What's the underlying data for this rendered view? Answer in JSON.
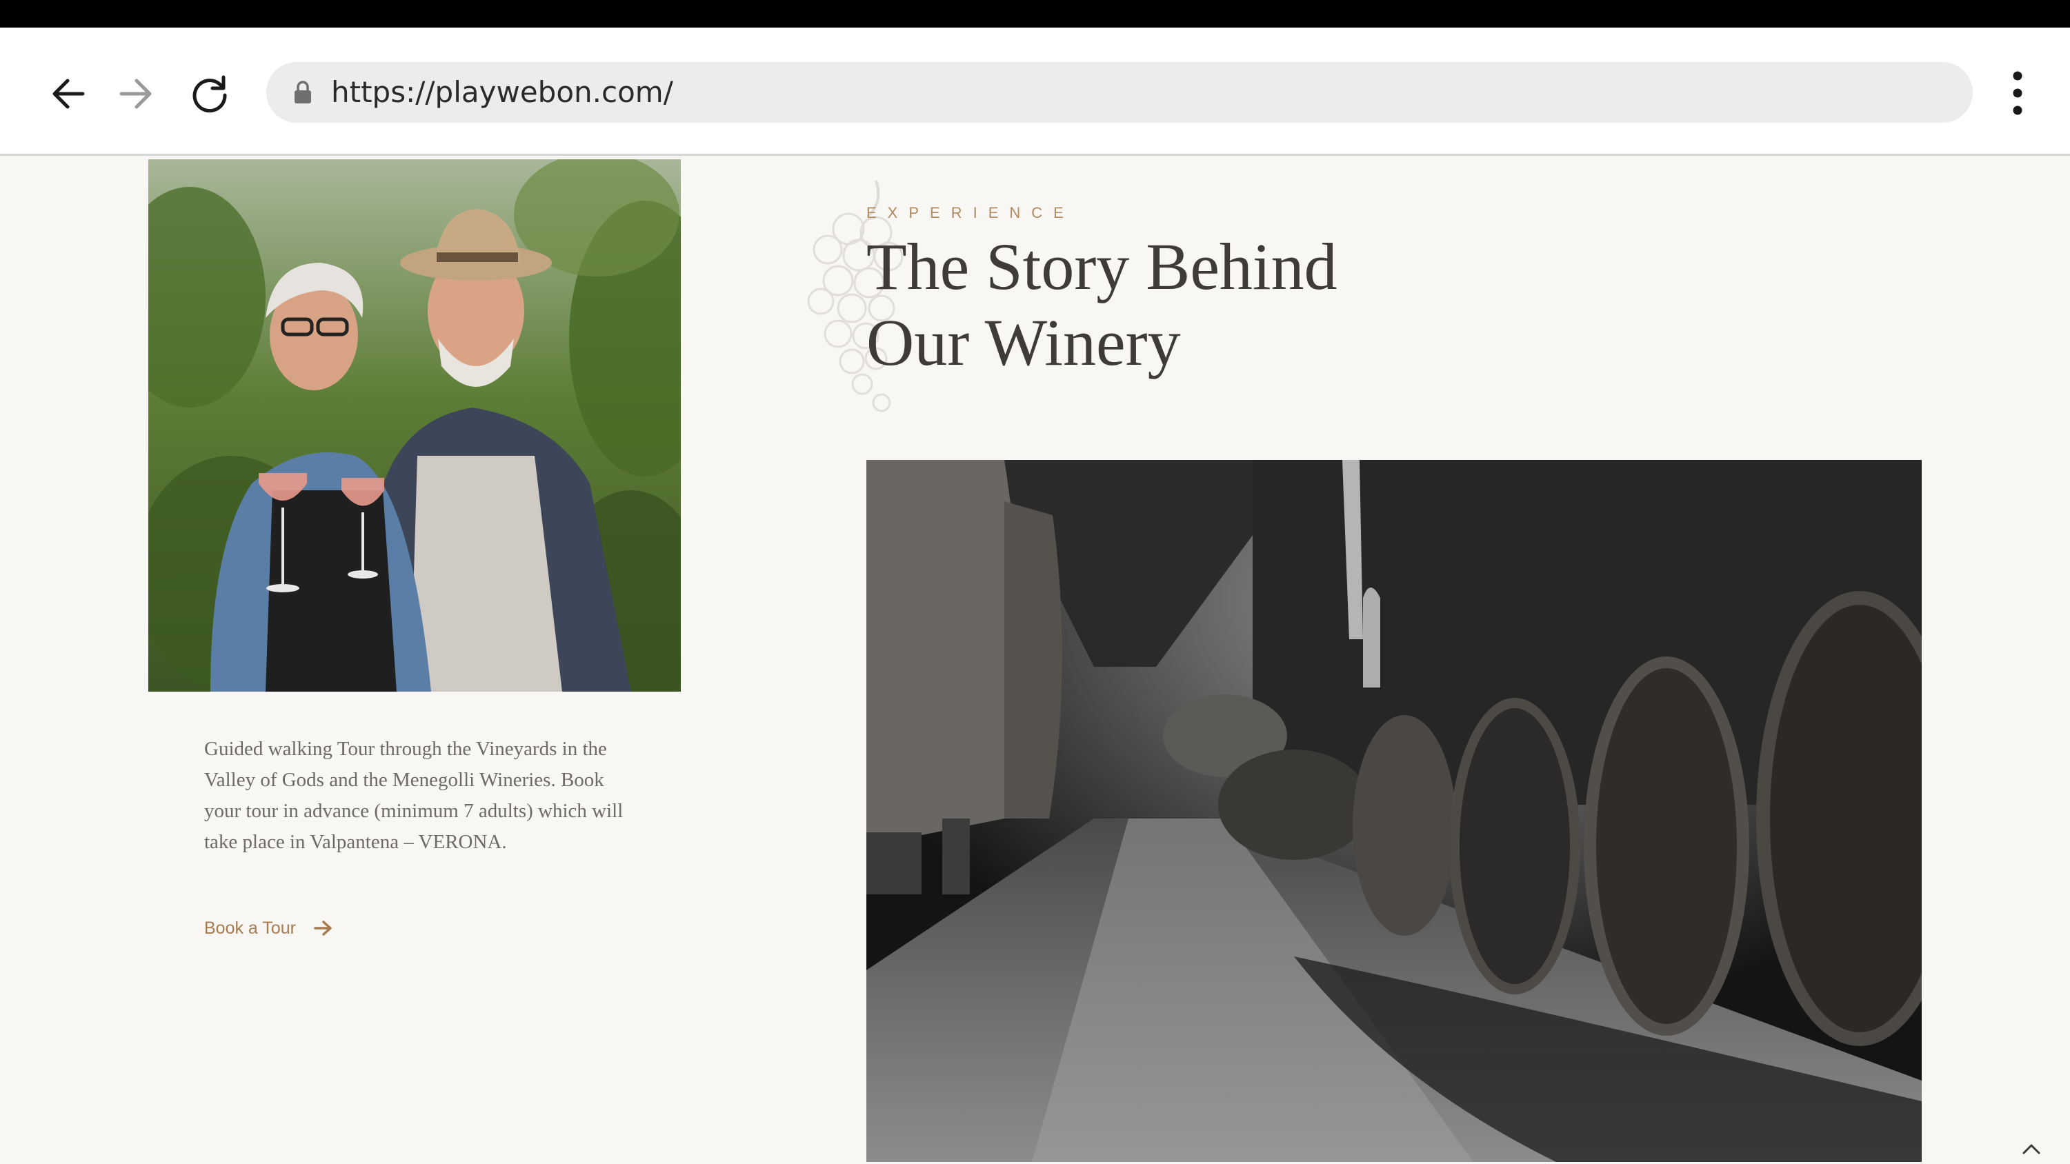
{
  "browser": {
    "url": "https://playwebon.com/",
    "icons": [
      "back-arrow-icon",
      "forward-arrow-icon",
      "reload-icon",
      "lock-icon",
      "more-vert-icon"
    ]
  },
  "intro": {
    "description": "Guided walking Tour through the Vineyards in the Valley of Gods and the Menegolli Wineries. Book your tour in advance (minimum 7 adults) which will take place in Valpantena – VERONA.",
    "cta_label": "Book a Tour"
  },
  "story": {
    "eyebrow": "EXPERIENCE",
    "heading_line1": "The Story Behind",
    "heading_line2": "Our Winery"
  },
  "colors": {
    "accent": "#b08a60",
    "heading": "#3f3b38",
    "body_text": "#6e6a66",
    "page_bg": "#f8f7f4"
  }
}
